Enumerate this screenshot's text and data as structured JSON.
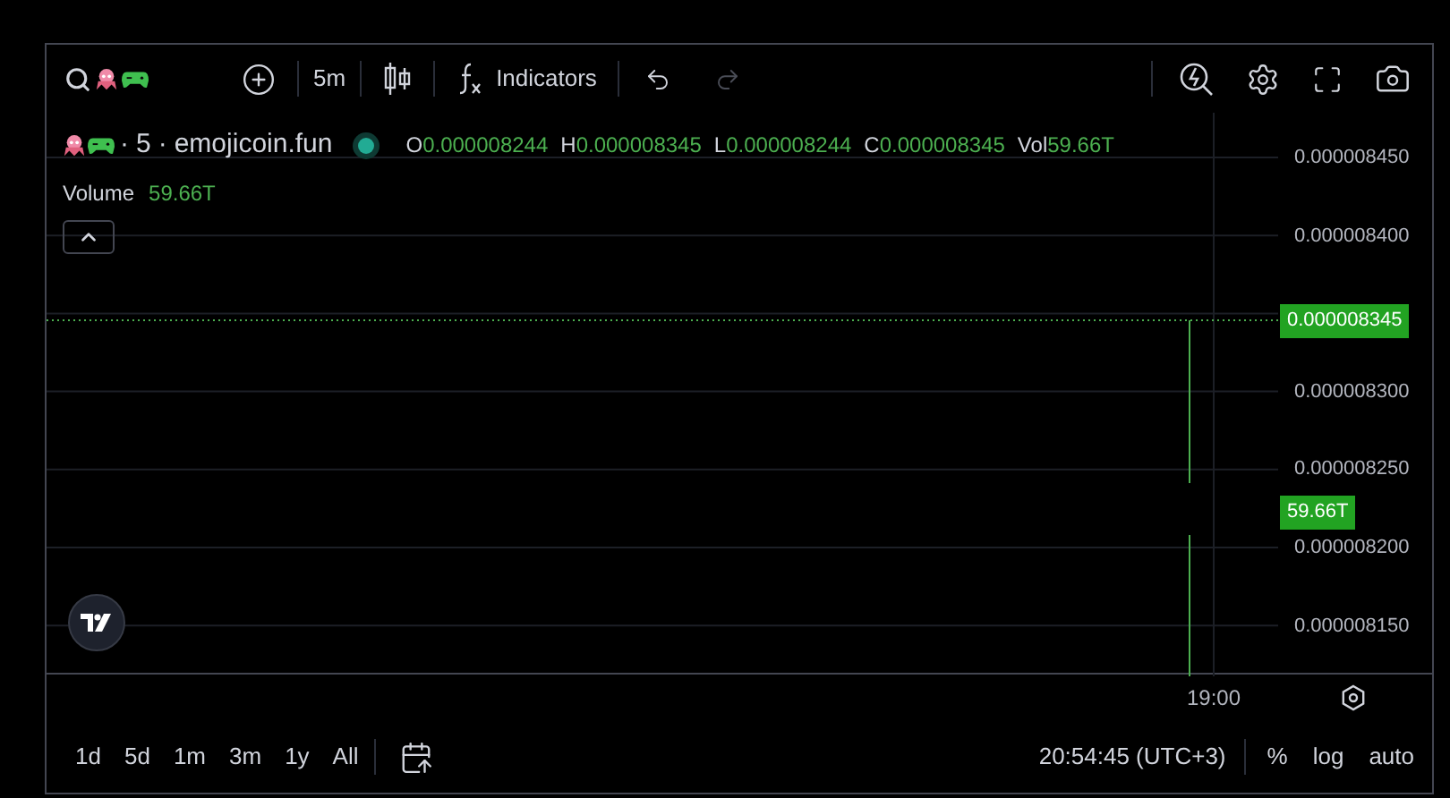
{
  "toolbar": {
    "interval": "5m",
    "indicators": "Indicators",
    "redo_disabled": true
  },
  "legend": {
    "separator_a": "·",
    "interval": "5",
    "separator_b": "·",
    "source": "emojicoin.fun",
    "market_open": true,
    "ohlc": [
      {
        "label": "O",
        "value": "0.000008244"
      },
      {
        "label": "H",
        "value": "0.000008345"
      },
      {
        "label": "L",
        "value": "0.000008244"
      },
      {
        "label": "C",
        "value": "0.000008345"
      },
      {
        "label": "Vol",
        "value": "59.66T"
      }
    ],
    "volume_label": "Volume",
    "volume_value": "59.66T"
  },
  "price_axis": [
    "0.000008450",
    "0.000008400",
    "0.000008300",
    "0.000008250",
    "0.000008200",
    "0.000008150"
  ],
  "last_price": "0.000008345",
  "volume_tag": "59.66T",
  "time_axis": [
    "19:00"
  ],
  "ranges": [
    "1d",
    "5d",
    "1m",
    "3m",
    "1y",
    "All"
  ],
  "clock": "20:54:45 (UTC+3)",
  "scale_options": [
    "%",
    "log",
    "auto"
  ]
}
